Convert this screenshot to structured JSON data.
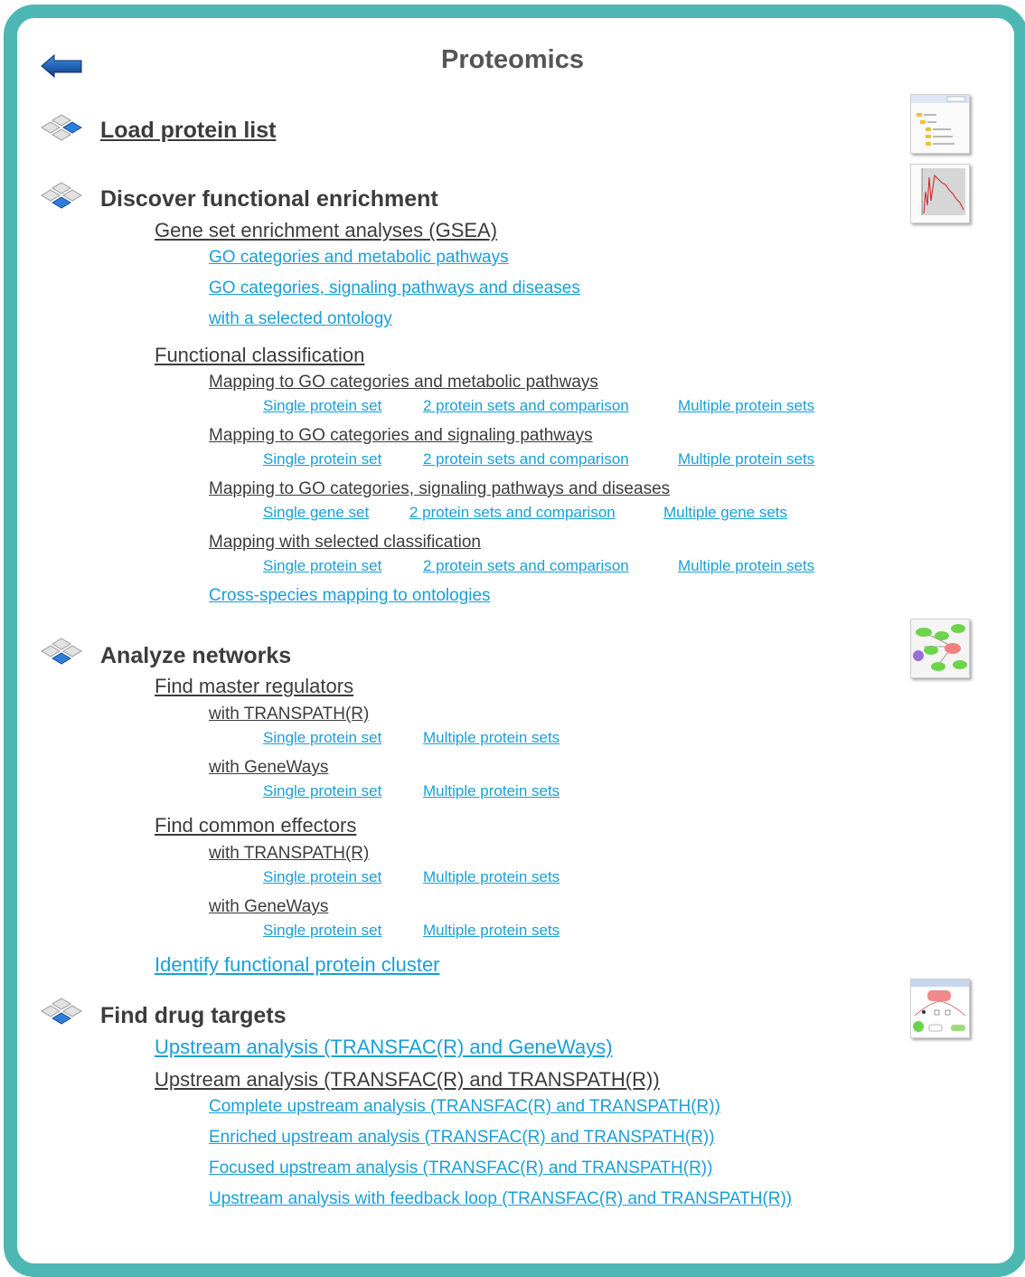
{
  "title": "Proteomics",
  "colors": {
    "frame": "#4db8b3",
    "link": "#1a9fd6",
    "text": "#3c3c3c",
    "accent": "#1f6fc8"
  },
  "icons": {
    "back": "back-arrow-icon",
    "section": "cube-stack-icon"
  },
  "sections": {
    "load": {
      "title": "Load protein list"
    },
    "enrichment": {
      "title": "Discover functional enrichment",
      "gsea": {
        "title": "Gene set enrichment analyses (GSEA)",
        "links": [
          "GO categories and metabolic pathways",
          "GO categories, signaling pathways and diseases",
          "with a selected ontology"
        ]
      },
      "classification": {
        "title": "Functional classification",
        "mappings": [
          {
            "title": "Mapping to GO categories and metabolic pathways",
            "links": [
              "Single protein set",
              "2 protein sets and comparison",
              "Multiple protein sets"
            ]
          },
          {
            "title": "Mapping to GO categories and signaling pathways",
            "links": [
              "Single protein set",
              "2 protein sets and comparison",
              "Multiple protein sets"
            ]
          },
          {
            "title": "Mapping to GO categories, signaling pathways and diseases",
            "links": [
              "Single gene set",
              "2 protein sets and comparison",
              "Multiple gene sets"
            ]
          },
          {
            "title": "Mapping with selected classification",
            "links": [
              "Single protein set",
              "2 protein sets and comparison",
              "Multiple protein sets"
            ]
          }
        ],
        "cross_species": "Cross-species mapping to ontologies"
      }
    },
    "networks": {
      "title": "Analyze networks",
      "master": {
        "title": "Find master regulators",
        "groups": [
          {
            "title": "with TRANSPATH(R)",
            "links": [
              "Single protein set",
              "Multiple protein sets"
            ]
          },
          {
            "title": "with GeneWays",
            "links": [
              "Single protein set",
              "Multiple protein sets"
            ]
          }
        ]
      },
      "effectors": {
        "title": "Find common effectors",
        "groups": [
          {
            "title": "with TRANSPATH(R)",
            "links": [
              "Single protein set",
              "Multiple protein sets"
            ]
          },
          {
            "title": "with GeneWays",
            "links": [
              "Single protein set",
              "Multiple protein sets"
            ]
          }
        ]
      },
      "cluster": "Identify functional protein cluster"
    },
    "drugs": {
      "title": "Find drug targets",
      "geneways": "Upstream analysis (TRANSFAC(R) and GeneWays)",
      "transpath": {
        "title": "Upstream analysis (TRANSFAC(R) and TRANSPATH(R))",
        "links": [
          "Complete upstream analysis (TRANSFAC(R) and TRANSPATH(R))",
          "Enriched upstream analysis (TRANSFAC(R) and TRANSPATH(R))",
          "Focused upstream analysis (TRANSFAC(R) and TRANSPATH(R))",
          "Upstream analysis with feedback loop (TRANSFAC(R) and TRANSPATH(R))"
        ]
      }
    }
  }
}
